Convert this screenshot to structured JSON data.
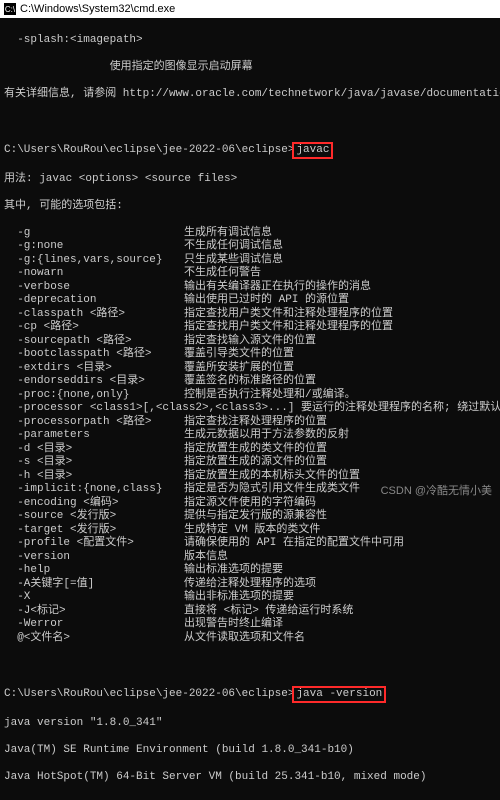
{
  "titlebar": {
    "icon": "C:\\",
    "path": "C:\\Windows\\System32\\cmd.exe"
  },
  "header": {
    "line1_opt": "  -splash:<imagepath>",
    "line1_desc": "                使用指定的图像显示启动屏幕",
    "line2": "有关详细信息, 请参阅 http://www.oracle.com/technetwork/java/javase/documentation/index.html"
  },
  "prompt1": {
    "path": "C:\\Users\\RouRou\\eclipse\\jee-2022-06\\eclipse>",
    "cmd": "javac"
  },
  "usage": {
    "line1": "用法: javac <options> <source files>",
    "line2": "其中, 可能的选项包括:"
  },
  "options": [
    {
      "opt": "  -g",
      "desc": "生成所有调试信息"
    },
    {
      "opt": "  -g:none",
      "desc": "不生成任何调试信息"
    },
    {
      "opt": "  -g:{lines,vars,source}",
      "desc": "只生成某些调试信息"
    },
    {
      "opt": "  -nowarn",
      "desc": "不生成任何警告"
    },
    {
      "opt": "  -verbose",
      "desc": "输出有关编译器正在执行的操作的消息"
    },
    {
      "opt": "  -deprecation",
      "desc": "输出使用已过时的 API 的源位置"
    },
    {
      "opt": "  -classpath <路径>",
      "desc": "指定查找用户类文件和注释处理程序的位置"
    },
    {
      "opt": "  -cp <路径>",
      "desc": "指定查找用户类文件和注释处理程序的位置"
    },
    {
      "opt": "  -sourcepath <路径>",
      "desc": "指定查找输入源文件的位置"
    },
    {
      "opt": "  -bootclasspath <路径>",
      "desc": "覆盖引导类文件的位置"
    },
    {
      "opt": "  -extdirs <目录>",
      "desc": "覆盖所安装扩展的位置"
    },
    {
      "opt": "  -endorseddirs <目录>",
      "desc": "覆盖签名的标准路径的位置"
    },
    {
      "opt": "  -proc:{none,only}",
      "desc": "控制是否执行注释处理和/或编译。"
    },
    {
      "opt": "  -processor <class1>[,<class2>,<class3>...]",
      "desc": "要运行的注释处理程序的名称; 绕过默认的搜索进程"
    },
    {
      "opt": "  -processorpath <路径>",
      "desc": "指定查找注释处理程序的位置"
    },
    {
      "opt": "  -parameters",
      "desc": "生成元数据以用于方法参数的反射"
    },
    {
      "opt": "  -d <目录>",
      "desc": "指定放置生成的类文件的位置"
    },
    {
      "opt": "  -s <目录>",
      "desc": "指定放置生成的源文件的位置"
    },
    {
      "opt": "  -h <目录>",
      "desc": "指定放置生成的本机标头文件的位置"
    },
    {
      "opt": "  -implicit:{none,class}",
      "desc": "指定是否为隐式引用文件生成类文件"
    },
    {
      "opt": "  -encoding <编码>",
      "desc": "指定源文件使用的字符编码"
    },
    {
      "opt": "  -source <发行版>",
      "desc": "提供与指定发行版的源兼容性"
    },
    {
      "opt": "  -target <发行版>",
      "desc": "生成特定 VM 版本的类文件"
    },
    {
      "opt": "  -profile <配置文件>",
      "desc": "请确保使用的 API 在指定的配置文件中可用"
    },
    {
      "opt": "  -version",
      "desc": "版本信息"
    },
    {
      "opt": "  -help",
      "desc": "输出标准选项的提要"
    },
    {
      "opt": "  -A关键字[=值]",
      "desc": "传递给注释处理程序的选项"
    },
    {
      "opt": "  -X",
      "desc": "输出非标准选项的提要"
    },
    {
      "opt": "  -J<标记>",
      "desc": "直接将 <标记> 传递给运行时系统"
    },
    {
      "opt": "  -Werror",
      "desc": "出现警告时终止编译"
    },
    {
      "opt": "  @<文件名>",
      "desc": "从文件读取选项和文件名"
    }
  ],
  "prompt2": {
    "path": "C:\\Users\\RouRou\\eclipse\\jee-2022-06\\eclipse>",
    "cmd": "java -version"
  },
  "version": {
    "line1": "java version \"1.8.0_341\"",
    "line2": "Java(TM) SE Runtime Environment (build 1.8.0_341-b10)",
    "line3": "Java HotSpot(TM) 64-Bit Server VM (build 25.341-b10, mixed mode)"
  },
  "watermark": "CSDN @冷酷无情小美"
}
